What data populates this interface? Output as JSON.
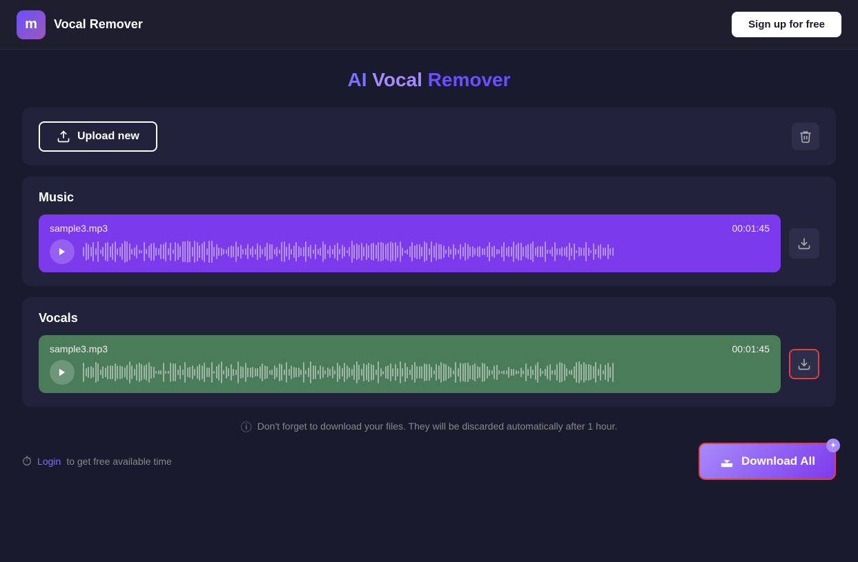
{
  "header": {
    "logo_text": "m",
    "app_name": "Vocal Remover",
    "signup_label": "Sign up for free"
  },
  "page": {
    "title_ai": "AI ",
    "title_vocal": "Vocal",
    "title_remover": " Remover"
  },
  "upload": {
    "button_label": "Upload new",
    "delete_label": "delete"
  },
  "music_section": {
    "title": "Music",
    "file_name": "sample3.mp3",
    "duration": "00:01:45"
  },
  "vocals_section": {
    "title": "Vocals",
    "file_name": "sample3.mp3",
    "duration": "00:01:45"
  },
  "notice": {
    "text": "Don't forget to download your files. They will be discarded automatically after 1 hour."
  },
  "footer": {
    "login_hint": "Login",
    "login_suffix": " to get free available time",
    "download_all_label": "Download All"
  }
}
